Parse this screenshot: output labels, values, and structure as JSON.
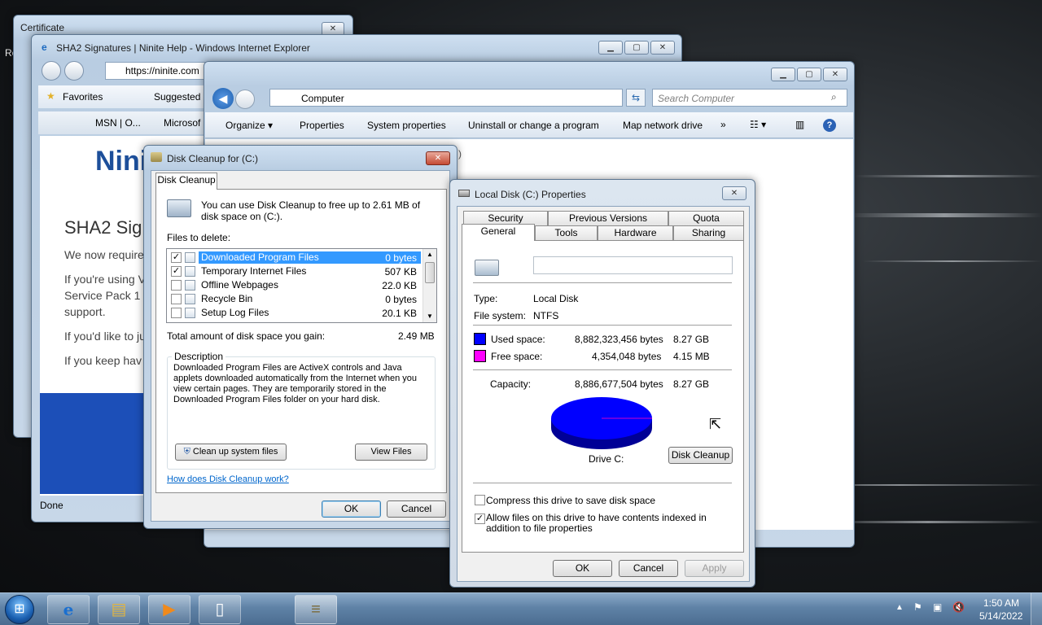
{
  "desktop": {
    "partial_text": "Re"
  },
  "certificate_window": {
    "title": "Certificate",
    "close": "✕"
  },
  "ie_window": {
    "title": "SHA2 Signatures | Ninite Help - Windows Internet Explorer",
    "address": "https://ninite.com",
    "favorites_label": "Favorites",
    "suggested_label": "Suggested S",
    "tabs": [
      "MSN | O...",
      "Microsof"
    ],
    "logo_text": "Nini",
    "heading": "SHA2 Sig",
    "paragraphs": [
      "We now require",
      "If you're using V",
      "Service Pack 1",
      "support.",
      "If you'd like to ju",
      "If you keep hav"
    ],
    "status": "Done"
  },
  "explorer_window": {
    "breadcrumb": "Computer",
    "search_placeholder": "Search Computer",
    "toolbar": [
      "Organize ▾",
      "Properties",
      "System properties",
      "Uninstall or change a program",
      "Map network drive",
      "»"
    ],
    "partial_text": ")"
  },
  "disk_cleanup": {
    "title": "Disk Cleanup for  (C:)",
    "tab": "Disk Cleanup",
    "intro": "You can use Disk Cleanup to free up to 2.61 MB of disk space on  (C:).",
    "files_label": "Files to delete:",
    "files": [
      {
        "name": "Downloaded Program Files",
        "size": "0 bytes",
        "checked": true,
        "selected": true
      },
      {
        "name": "Temporary Internet Files",
        "size": "507 KB",
        "checked": true,
        "selected": false
      },
      {
        "name": "Offline Webpages",
        "size": "22.0 KB",
        "checked": false,
        "selected": false
      },
      {
        "name": "Recycle Bin",
        "size": "0 bytes",
        "checked": false,
        "selected": false
      },
      {
        "name": "Setup Log Files",
        "size": "20.1 KB",
        "checked": false,
        "selected": false
      }
    ],
    "total_label": "Total amount of disk space you gain:",
    "total_value": "2.49 MB",
    "description_label": "Description",
    "description": "Downloaded Program Files are ActiveX controls and Java applets downloaded automatically from the Internet when you view certain pages. They are temporarily stored in the Downloaded Program Files folder on your hard disk.",
    "clean_system_button": "Clean up system files",
    "view_files_button": "View Files",
    "help_link": "How does Disk Cleanup work?",
    "ok": "OK",
    "cancel": "Cancel"
  },
  "properties": {
    "title": "Local Disk (C:) Properties",
    "tabs_row1": [
      "Security",
      "Previous Versions",
      "Quota"
    ],
    "tabs_row2": [
      "General",
      "Tools",
      "Hardware",
      "Sharing"
    ],
    "type_label": "Type:",
    "type_value": "Local Disk",
    "fs_label": "File system:",
    "fs_value": "NTFS",
    "used_label": "Used space:",
    "used_bytes": "8,882,323,456 bytes",
    "used_gb": "8.27 GB",
    "free_label": "Free space:",
    "free_bytes": "4,354,048 bytes",
    "free_gb": "4.15 MB",
    "capacity_label": "Capacity:",
    "capacity_bytes": "8,886,677,504 bytes",
    "capacity_gb": "8.27 GB",
    "used_color": "#0000ff",
    "free_color": "#ff00ff",
    "drive_label": "Drive C:",
    "disk_cleanup_button": "Disk Cleanup",
    "compress_label": "Compress this drive to save disk space",
    "compress_checked": false,
    "index_label": "Allow files on this drive to have contents indexed in addition to file properties",
    "index_checked": true,
    "ok": "OK",
    "cancel": "Cancel",
    "apply": "Apply"
  },
  "taskbar": {
    "time": "1:50 AM",
    "date": "5/14/2022",
    "items": [
      "start-orb",
      "ie-icon",
      "explorer-icon",
      "media-player-icon",
      "document-icon",
      "disk-cleanup-icon"
    ]
  }
}
